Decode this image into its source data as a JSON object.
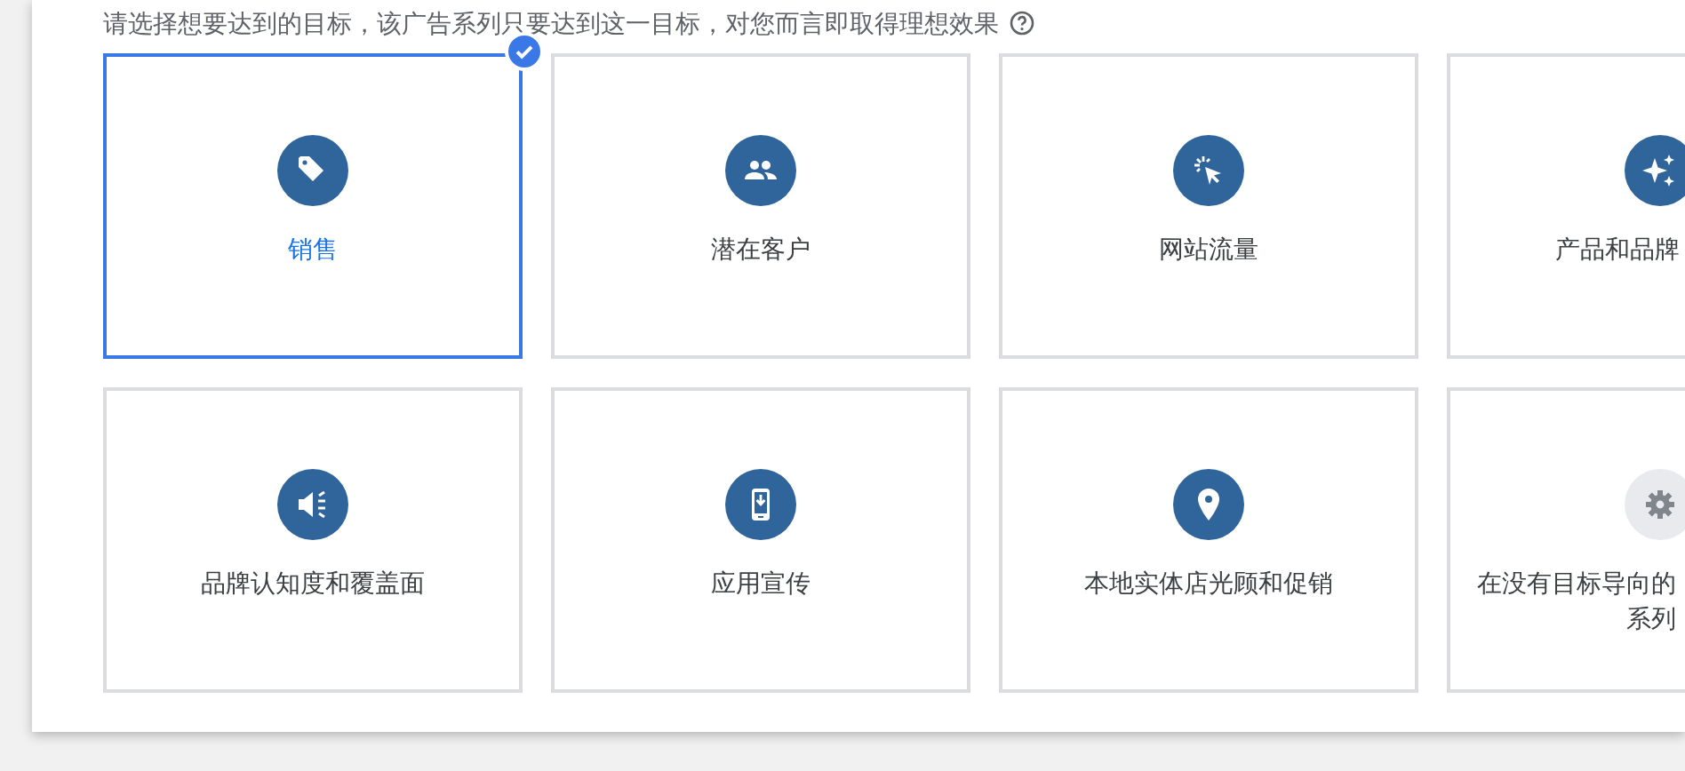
{
  "instruction": "请选择想要达到的目标，该广告系列只要达到这一目标，对您而言即取得理想效果",
  "goals": [
    {
      "label": "销售",
      "selected": true
    },
    {
      "label": "潜在客户",
      "selected": false
    },
    {
      "label": "网站流量",
      "selected": false
    },
    {
      "label": "产品和品牌",
      "selected": false
    },
    {
      "label": "品牌认知度和覆盖面",
      "selected": false
    },
    {
      "label": "应用宣传",
      "selected": false
    },
    {
      "label": "本地实体店光顾和促销",
      "selected": false
    },
    {
      "label": "在没有目标导向的系列",
      "selected": false
    }
  ]
}
